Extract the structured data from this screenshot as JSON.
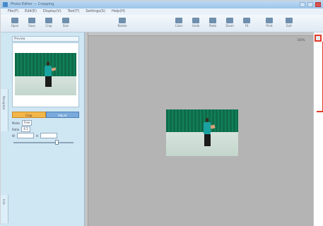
{
  "window": {
    "title": "Photo Editor — Cropping"
  },
  "menubar": {
    "items": [
      "File(F)",
      "Edit(E)",
      "Display(V)",
      "Tool(T)",
      "Settings(S)",
      "Help(H)"
    ]
  },
  "toolbar": {
    "buttons": [
      {
        "label": "Open",
        "icon": "folder-icon"
      },
      {
        "label": "Save",
        "icon": "save-icon"
      },
      {
        "label": "Crop",
        "icon": "crop-icon"
      },
      {
        "label": "Size",
        "icon": "resize-icon"
      },
      {
        "label": "Rotate",
        "icon": "rotate-icon"
      },
      {
        "label": "Color",
        "icon": "color-icon"
      },
      {
        "label": "Undo",
        "icon": "undo-icon"
      },
      {
        "label": "Redo",
        "icon": "redo-icon"
      },
      {
        "label": "Zoom",
        "icon": "zoom-icon"
      },
      {
        "label": "Fit",
        "icon": "fit-icon"
      },
      {
        "label": "Print",
        "icon": "print-icon"
      },
      {
        "label": "Exit",
        "icon": "exit-icon"
      }
    ]
  },
  "left_panel": {
    "vtab_top": "Navigator",
    "vtab_bottom": "Info",
    "panel_header": "Preview",
    "tabs": [
      "Crop",
      "Adjust"
    ],
    "ctrl_mode_label": "Mode",
    "ctrl_mode_value": "Free",
    "ctrl_ratio_label": "Ratio",
    "ctrl_ratio_value": "4:3",
    "ctrl_width_label": "W",
    "ctrl_height_label": "H",
    "slider_level": 0.72
  },
  "canvas": {
    "zoom_label": "100%"
  },
  "colors": {
    "titlebar": "#a8cdee",
    "panel": "#cfe6f3",
    "canvas": "#b4b4b4",
    "highlight": "#e23a2a"
  }
}
